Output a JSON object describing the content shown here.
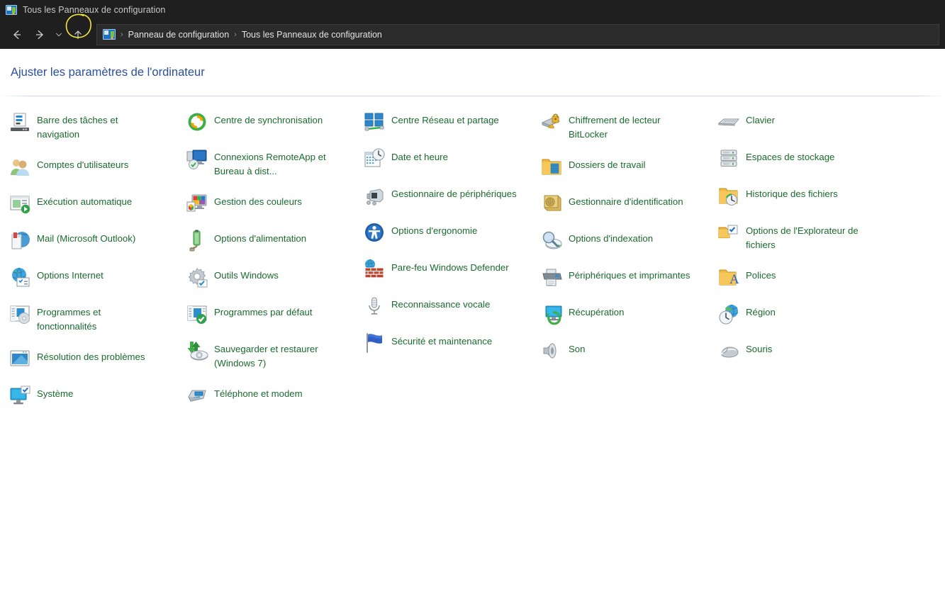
{
  "window": {
    "title": "Tous les Panneaux de configuration",
    "icon": "control-panel-icon"
  },
  "nav": {
    "back_icon": "arrow-left-icon",
    "forward_icon": "arrow-right-icon",
    "recent_icon": "chevron-down-icon",
    "up_icon": "arrow-up-icon",
    "annotation": "yellow-ellipse-highlight-on-up-button"
  },
  "breadcrumb": {
    "icon": "control-panel-icon",
    "separator": "›",
    "items": [
      "Panneau de configuration",
      "Tous les Panneaux de configuration"
    ]
  },
  "main": {
    "heading": "Ajuster les paramètres de l'ordinateur",
    "columns": [
      {
        "items": [
          {
            "label": "Barre des tâches et navigation",
            "icon": "taskbar-icon"
          },
          {
            "label": "Comptes d'utilisateurs",
            "icon": "user-accounts-icon"
          },
          {
            "label": "Exécution automatique",
            "icon": "autoplay-icon"
          },
          {
            "label": "Mail (Microsoft Outlook)",
            "icon": "mail-icon"
          },
          {
            "label": "Options Internet",
            "icon": "internet-options-icon"
          },
          {
            "label": "Programmes et fonctionnalités",
            "icon": "programs-features-icon"
          },
          {
            "label": "Résolution des problèmes",
            "icon": "troubleshooting-icon"
          },
          {
            "label": "Système",
            "icon": "system-icon"
          }
        ]
      },
      {
        "items": [
          {
            "label": "Centre de synchronisation",
            "icon": "sync-center-icon"
          },
          {
            "label": "Connexions RemoteApp et Bureau à dist...",
            "icon": "remoteapp-icon"
          },
          {
            "label": "Gestion des couleurs",
            "icon": "color-management-icon"
          },
          {
            "label": "Options d'alimentation",
            "icon": "power-options-icon"
          },
          {
            "label": "Outils Windows",
            "icon": "windows-tools-icon"
          },
          {
            "label": "Programmes par défaut",
            "icon": "default-programs-icon"
          },
          {
            "label": "Sauvegarder et restaurer (Windows 7)",
            "icon": "backup-restore-icon"
          },
          {
            "label": "Téléphone et modem",
            "icon": "phone-modem-icon"
          }
        ]
      },
      {
        "items": [
          {
            "label": "Centre Réseau et partage",
            "icon": "network-sharing-icon"
          },
          {
            "label": "Date et heure",
            "icon": "date-time-icon"
          },
          {
            "label": "Gestionnaire de périphériques",
            "icon": "device-manager-icon"
          },
          {
            "label": "Options d'ergonomie",
            "icon": "ease-of-access-icon"
          },
          {
            "label": "Pare-feu Windows Defender",
            "icon": "firewall-icon"
          },
          {
            "label": "Reconnaissance vocale",
            "icon": "speech-recognition-icon"
          },
          {
            "label": "Sécurité et maintenance",
            "icon": "security-maintenance-icon"
          }
        ]
      },
      {
        "items": [
          {
            "label": "Chiffrement de lecteur BitLocker",
            "icon": "bitlocker-icon"
          },
          {
            "label": "Dossiers de travail",
            "icon": "work-folders-icon"
          },
          {
            "label": "Gestionnaire d'identification",
            "icon": "credential-manager-icon"
          },
          {
            "label": "Options d'indexation",
            "icon": "indexing-options-icon"
          },
          {
            "label": "Périphériques et imprimantes",
            "icon": "devices-printers-icon"
          },
          {
            "label": "Récupération",
            "icon": "recovery-icon"
          },
          {
            "label": "Son",
            "icon": "sound-icon"
          }
        ]
      },
      {
        "items": [
          {
            "label": "Clavier",
            "icon": "keyboard-icon"
          },
          {
            "label": "Espaces de stockage",
            "icon": "storage-spaces-icon"
          },
          {
            "label": "Historique des fichiers",
            "icon": "file-history-icon"
          },
          {
            "label": "Options de l'Explorateur de fichiers",
            "icon": "file-explorer-options-icon"
          },
          {
            "label": "Polices",
            "icon": "fonts-icon"
          },
          {
            "label": "Région",
            "icon": "region-icon"
          },
          {
            "label": "Souris",
            "icon": "mouse-icon"
          }
        ]
      }
    ]
  },
  "colors": {
    "titlebar_bg": "#1f1f1f",
    "addressbar_bg": "#2b2b2b",
    "content_bg": "#ffffff",
    "link_green": "#1a6b2e",
    "heading_blue": "#2c4f9e",
    "divider_blue": "#c6d9ef",
    "annotation_yellow": "#f2e63c"
  }
}
